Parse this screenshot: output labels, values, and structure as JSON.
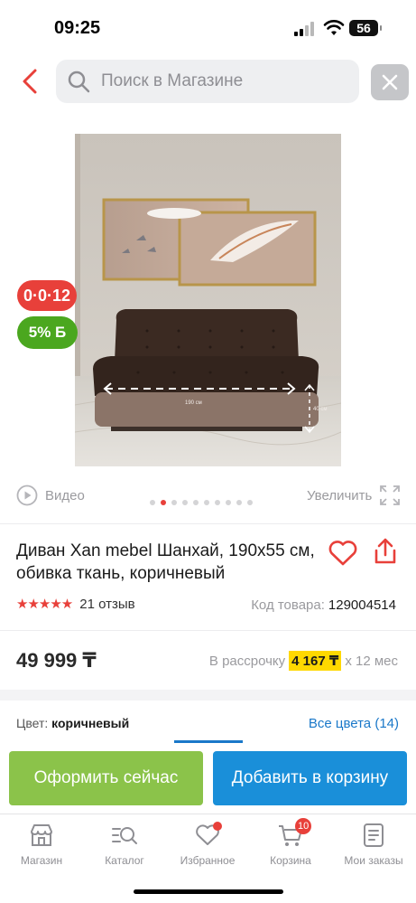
{
  "status_bar": {
    "time": "09:25",
    "battery": "56"
  },
  "search": {
    "placeholder": "Поиск в Магазине"
  },
  "badges": {
    "installment": "0·0·12",
    "bonus": "5% Б"
  },
  "gallery": {
    "video_label": "Видео",
    "zoom_label": "Увеличить",
    "dot_count": 10,
    "active_dot": 1,
    "width_marker": "190 см",
    "height_marker": "40 см"
  },
  "product": {
    "title": "Диван Xan mebel Шанхай, 190x55 см, обивка ткань, коричневый",
    "rating_stars": 5,
    "reviews": "21 отзыв",
    "code_label": "Код товара:",
    "code": "129004514",
    "price": "49 999 ₸",
    "installment_prefix": "В рассрочку",
    "installment_amount": "4 167 ₸",
    "installment_suffix": "x 12 мес",
    "color_label": "Цвет:",
    "color_value": "коричневый",
    "all_colors": "Все цвета (14)"
  },
  "actions": {
    "checkout": "Оформить сейчас",
    "add_to_cart": "Добавить в корзину"
  },
  "tabbar": {
    "items": [
      {
        "label": "Магазин",
        "icon": "shop-icon"
      },
      {
        "label": "Каталог",
        "icon": "catalog-search-icon"
      },
      {
        "label": "Избранное",
        "icon": "heart-icon"
      },
      {
        "label": "Корзина",
        "icon": "cart-icon"
      },
      {
        "label": "Мои заказы",
        "icon": "orders-icon"
      }
    ],
    "cart_count": "10"
  },
  "colors": {
    "accent_red": "#e8403a",
    "green": "#8bc34a",
    "blue": "#1a8fd9",
    "link": "#1a78c9",
    "installment_highlight": "#ffd800"
  }
}
